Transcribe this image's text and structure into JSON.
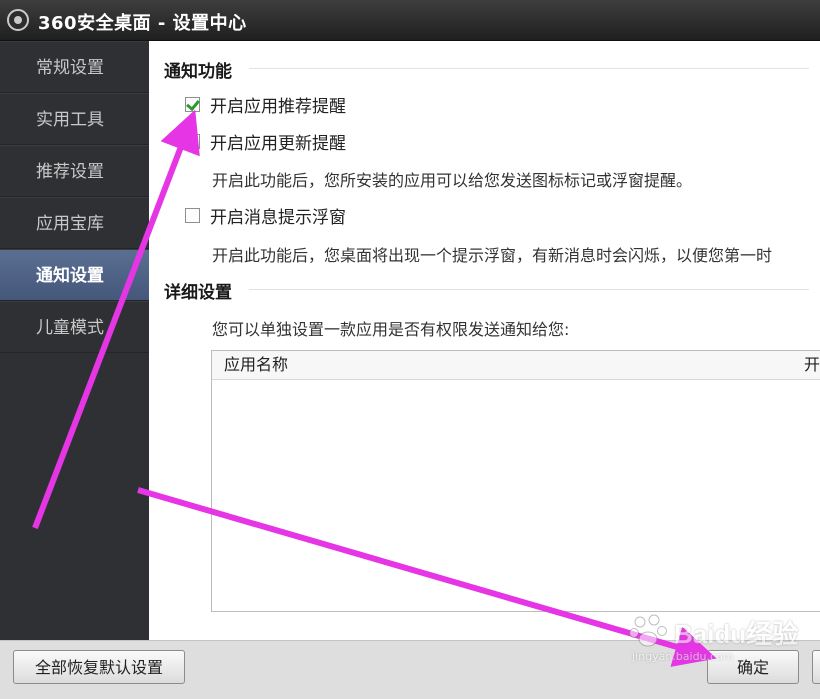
{
  "window": {
    "title": "360安全桌面 - 设置中心"
  },
  "sidebar": {
    "items": [
      {
        "label": "常规设置",
        "active": false
      },
      {
        "label": "实用工具",
        "active": false
      },
      {
        "label": "推荐设置",
        "active": false
      },
      {
        "label": "应用宝库",
        "active": false
      },
      {
        "label": "通知设置",
        "active": true
      },
      {
        "label": "儿童模式",
        "active": false
      }
    ]
  },
  "notify": {
    "section_title": "通知功能",
    "options": [
      {
        "label": "开启应用推荐提醒",
        "checked": true
      },
      {
        "label": "开启应用更新提醒",
        "checked": false
      },
      {
        "label": "开启消息提示浮窗",
        "checked": false
      }
    ],
    "update_desc": "开启此功能后，您所安装的应用可以给您发送图标标记或浮窗提醒。",
    "popup_desc": "开启此功能后，您桌面将出现一个提示浮窗，有新消息时会闪烁，以便您第一时"
  },
  "detail": {
    "section_title": "详细设置",
    "desc": "您可以单独设置一款应用是否有权限发送通知给您:",
    "table": {
      "columns": [
        "应用名称",
        "开"
      ],
      "rows": []
    }
  },
  "footer": {
    "restore_label": "全部恢复默认设置",
    "ok_label": "确定"
  },
  "watermark": {
    "text": "Baidu经验",
    "sub": "jingyan.baidu.com"
  },
  "colors": {
    "annotation_arrow": "#e535e5",
    "active_nav": "#4a5c80",
    "check_mark": "#2b9a2b"
  }
}
